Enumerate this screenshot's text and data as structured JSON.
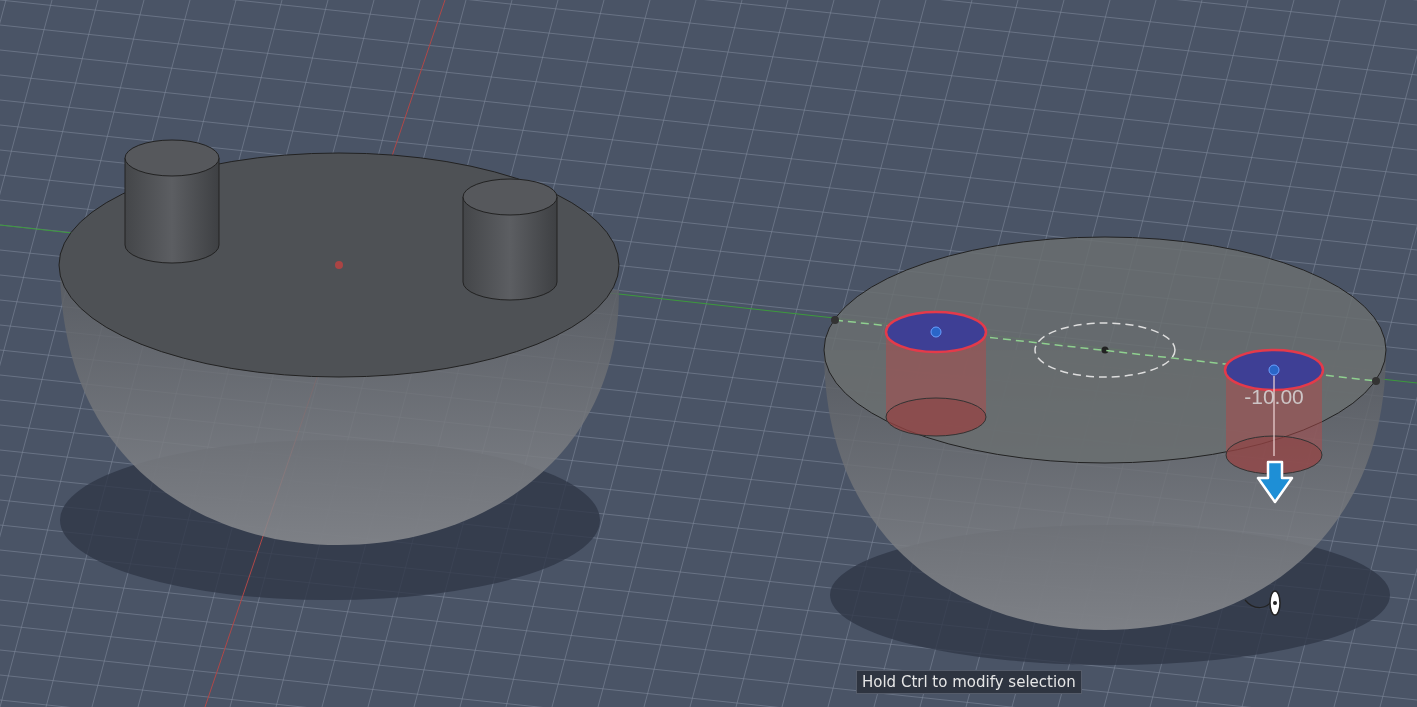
{
  "viewport": {
    "dimension_value": "-10.00"
  },
  "tooltip": {
    "text": "Hold Ctrl to modify selection"
  }
}
